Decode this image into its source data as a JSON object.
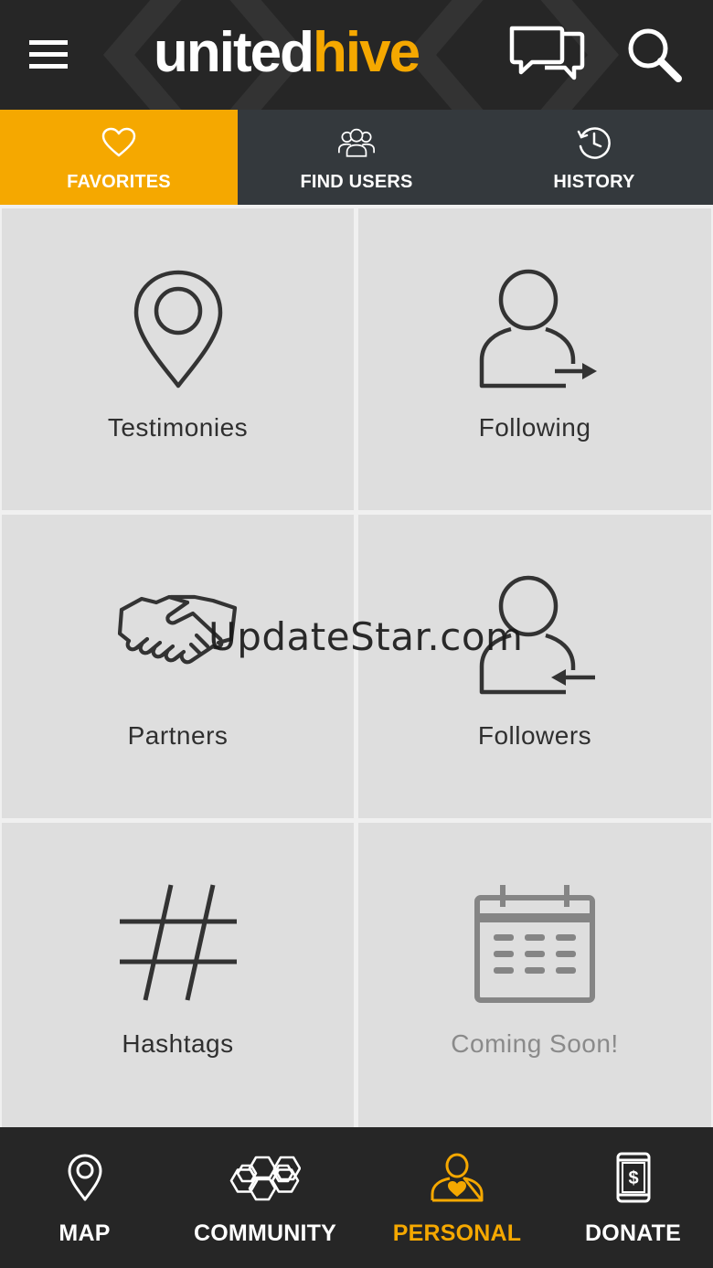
{
  "header": {
    "logo_part1": "united",
    "logo_part2": "hive"
  },
  "tabs": [
    {
      "label": "FAVORITES",
      "icon": "heart-icon",
      "active": true
    },
    {
      "label": "FIND USERS",
      "icon": "users-icon",
      "active": false
    },
    {
      "label": "HISTORY",
      "icon": "history-icon",
      "active": false
    }
  ],
  "grid": [
    {
      "label": "Testimonies",
      "icon": "map-pin-icon"
    },
    {
      "label": "Following",
      "icon": "user-following-icon"
    },
    {
      "label": "Partners",
      "icon": "handshake-icon"
    },
    {
      "label": "Followers",
      "icon": "user-followers-icon"
    },
    {
      "label": "Hashtags",
      "icon": "hashtag-icon"
    },
    {
      "label": "Coming Soon!",
      "icon": "calendar-icon"
    }
  ],
  "watermark": "UpdateStar.com",
  "bottom_nav": [
    {
      "label": "MAP",
      "icon": "map-pin-icon",
      "active": false
    },
    {
      "label": "COMMUNITY",
      "icon": "hexagons-icon",
      "active": false
    },
    {
      "label": "PERSONAL",
      "icon": "person-icon",
      "active": true
    },
    {
      "label": "DONATE",
      "icon": "phone-dollar-icon",
      "active": false
    }
  ],
  "colors": {
    "accent": "#f5a800",
    "header_bg": "#262626",
    "tabs_bg": "#34393d",
    "cell_bg": "#dedede",
    "text_dark": "#2f2f2f",
    "text_muted": "#8a8a8a"
  }
}
